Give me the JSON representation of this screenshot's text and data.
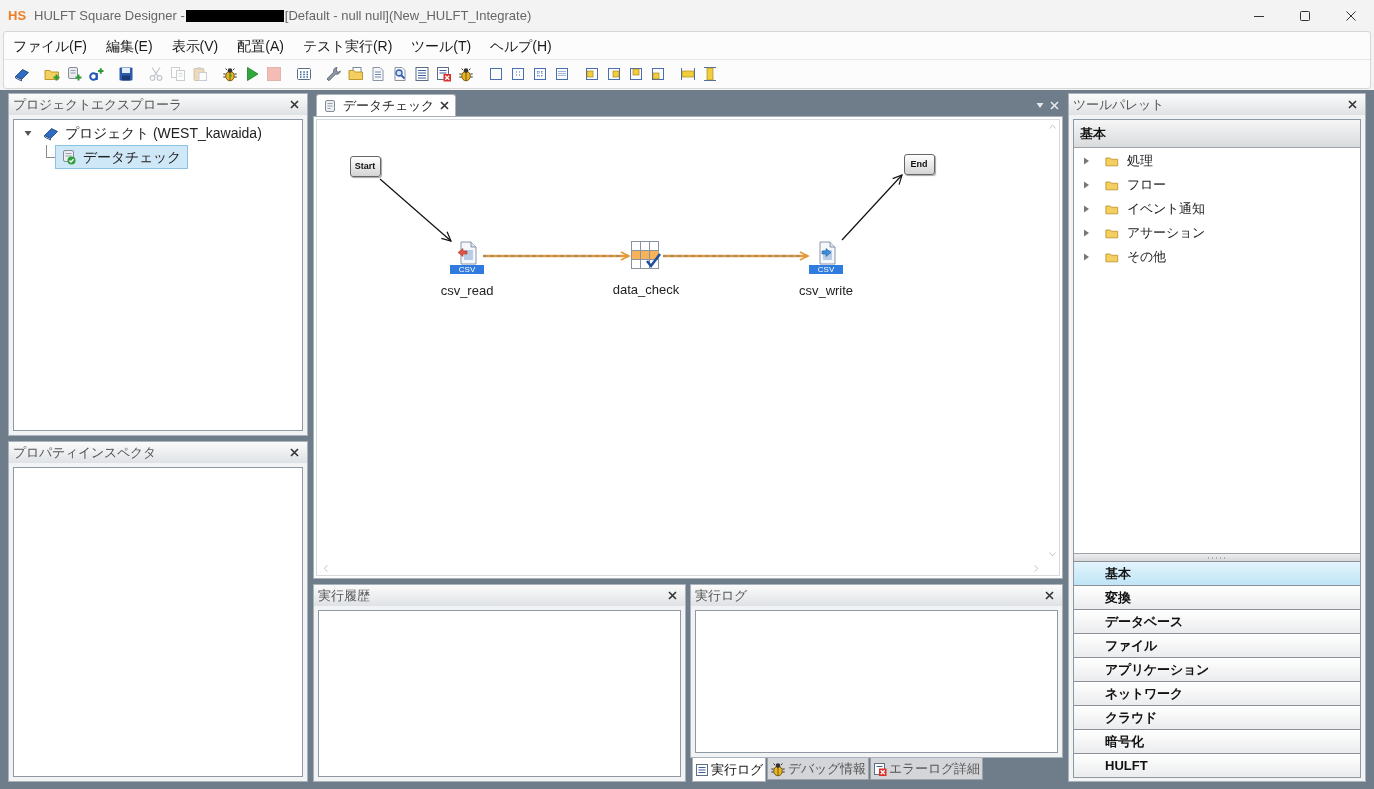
{
  "window": {
    "logo": "HS",
    "title_prefix": "HULFT Square Designer -",
    "title_suffix": "[Default - null null](New_HULFT_Integrate)"
  },
  "menu": [
    "ファイル(F)",
    "編集(E)",
    "表示(V)",
    "配置(A)",
    "テスト実行(R)",
    "ツール(T)",
    "ヘルプ(H)"
  ],
  "toolbar": [
    {
      "items": [
        {
          "kind": "book",
          "disabled": false
        }
      ]
    },
    {
      "items": [
        {
          "kind": "folderadd",
          "disabled": false
        },
        {
          "kind": "scrolladd",
          "disabled": false
        },
        {
          "kind": "textadd",
          "disabled": false
        }
      ]
    },
    {
      "items": [
        {
          "kind": "save",
          "disabled": false
        }
      ]
    },
    {
      "items": [
        {
          "kind": "cut",
          "disabled": true
        },
        {
          "kind": "copy",
          "disabled": true
        },
        {
          "kind": "paste",
          "disabled": true
        }
      ]
    },
    {
      "items": [
        {
          "kind": "debugrun",
          "disabled": false
        },
        {
          "kind": "run",
          "disabled": false
        },
        {
          "kind": "stop",
          "disabled": true
        }
      ]
    },
    {
      "items": [
        {
          "kind": "keypad",
          "disabled": false
        }
      ]
    },
    {
      "items": [
        {
          "kind": "wrench",
          "disabled": false
        },
        {
          "kind": "folder",
          "disabled": false
        },
        {
          "kind": "report",
          "disabled": false
        },
        {
          "kind": "inspect",
          "disabled": false
        },
        {
          "kind": "list",
          "disabled": false
        },
        {
          "kind": "errorlist",
          "disabled": false
        },
        {
          "kind": "bug",
          "disabled": false
        }
      ]
    },
    {
      "items": [
        {
          "kind": "frame",
          "disabled": false
        },
        {
          "kind": "dotframe",
          "disabled": false
        },
        {
          "kind": "gridframe",
          "disabled": false
        },
        {
          "kind": "densegrid",
          "disabled": false
        }
      ]
    },
    {
      "items": [
        {
          "kind": "alignleft",
          "disabled": false
        },
        {
          "kind": "alignright",
          "disabled": false
        },
        {
          "kind": "aligntop",
          "disabled": false
        },
        {
          "kind": "alignbottom",
          "disabled": false
        }
      ]
    },
    {
      "items": [
        {
          "kind": "samewidth",
          "disabled": false
        },
        {
          "kind": "sameheight",
          "disabled": false
        }
      ]
    }
  ],
  "project_explorer": {
    "title": "プロジェクトエクスプローラ",
    "tree": [
      {
        "kind": "project",
        "label": "プロジェクト (WEST_kawaida)",
        "expanded": true,
        "selected": false,
        "children": [
          {
            "kind": "flow",
            "label": "データチェック",
            "selected": true
          }
        ]
      }
    ]
  },
  "property_inspector": {
    "title": "プロパティインスペクタ"
  },
  "editor": {
    "tabs": [
      {
        "label": "データチェック",
        "selected": true
      }
    ],
    "nodes": [
      {
        "kind": "terminal",
        "label": "Start"
      },
      {
        "kind": "reader",
        "label": "csv_read",
        "file_type": "CSV"
      },
      {
        "kind": "checker",
        "label": "data_check"
      },
      {
        "kind": "writer",
        "label": "csv_write",
        "file_type": "CSV"
      },
      {
        "kind": "terminal",
        "label": "End"
      }
    ],
    "connectors": [
      {
        "kind": "control"
      },
      {
        "kind": "data"
      },
      {
        "kind": "data"
      },
      {
        "kind": "control"
      }
    ]
  },
  "run_history": {
    "title": "実行履歴"
  },
  "run_log": {
    "title": "実行ログ",
    "tabs": [
      {
        "kind": "log",
        "label": "実行ログ",
        "selected": true
      },
      {
        "kind": "debug",
        "label": "デバッグ情報",
        "selected": false
      },
      {
        "kind": "error",
        "label": "エラーログ詳細",
        "selected": false
      }
    ]
  },
  "tool_palette": {
    "title": "ツールパレット",
    "group": "基本",
    "tree": [
      {
        "label": "処理",
        "expanded": false,
        "selected": false
      },
      {
        "label": "フロー",
        "expanded": false,
        "selected": false
      },
      {
        "label": "イベント通知",
        "expanded": false,
        "selected": false
      },
      {
        "label": "アサーション",
        "expanded": false,
        "selected": false
      },
      {
        "label": "その他",
        "expanded": false,
        "selected": false
      }
    ],
    "categories": [
      {
        "label": "基本",
        "selected": true
      },
      {
        "label": "変換",
        "selected": false
      },
      {
        "label": "データベース",
        "selected": false
      },
      {
        "label": "ファイル",
        "selected": false
      },
      {
        "label": "アプリケーション",
        "selected": false
      },
      {
        "label": "ネットワーク",
        "selected": false
      },
      {
        "label": "クラウド",
        "selected": false
      },
      {
        "label": "暗号化",
        "selected": false
      },
      {
        "label": "HULFT",
        "selected": false
      }
    ]
  }
}
